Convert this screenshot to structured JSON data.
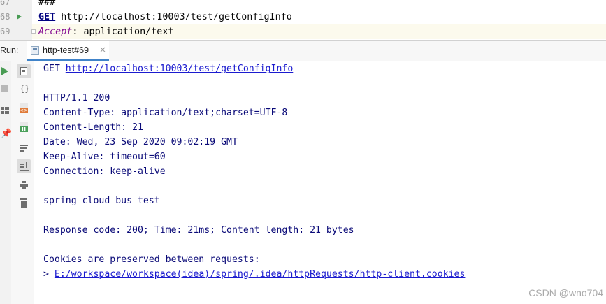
{
  "editor": {
    "lines": [
      {
        "num": "67",
        "text": "###"
      },
      {
        "num": "68",
        "method": "GET",
        "url": " http://localhost:10003/test/getConfigInfo"
      },
      {
        "num": "69",
        "header_key": "Accept",
        "header_value": ": application/text"
      }
    ]
  },
  "run_panel": {
    "label": "Run:",
    "tab_label": "http-test#69",
    "tab_close": "×"
  },
  "console": {
    "request_method": "GET ",
    "request_url": "http://localhost:10003/test/getConfigInfo",
    "status_line": "HTTP/1.1 200",
    "headers": [
      "Content-Type: application/text;charset=UTF-8",
      "Content-Length: 21",
      "Date: Wed, 23 Sep 2020 09:02:19 GMT",
      "Keep-Alive: timeout=60",
      "Connection: keep-alive"
    ],
    "body": "spring cloud bus test",
    "summary": "Response code: 200; Time: 21ms; Content length: 21 bytes",
    "cookies_note": "Cookies are preserved between requests:",
    "cookies_prefix": "> ",
    "cookies_path": "E:/workspace/workspace(idea)/spring/.idea/httpRequests/http-client.cookies"
  },
  "icons": {
    "run": "play-icon",
    "stop": "stop-icon",
    "layout": "layout-icon",
    "pin": "pin-icon",
    "colors": {
      "run": "#499c54",
      "accent": "#4083c9",
      "text": "#0a0a78",
      "link": "#1b1bcf"
    }
  },
  "watermark": "CSDN @wno704"
}
